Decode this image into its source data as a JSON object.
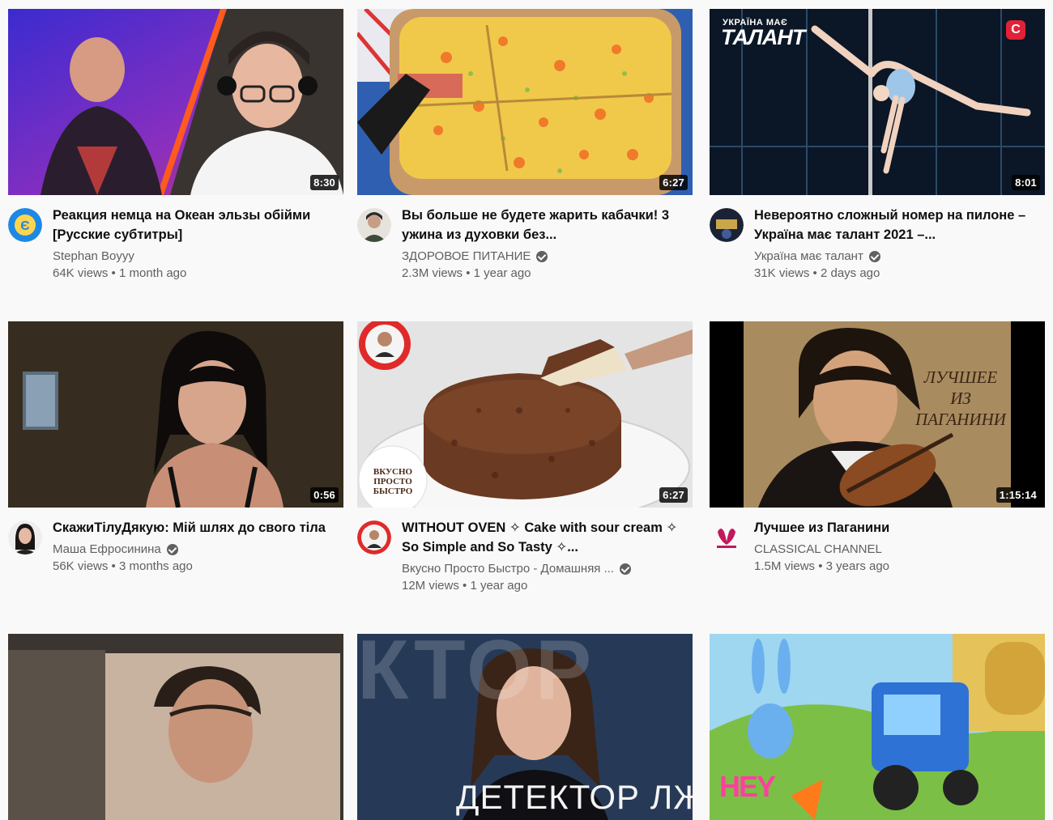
{
  "videos": [
    {
      "title": "Реакция немца на Океан эльзы обійми [Русские субтитры]",
      "channel": "Stephan Boyyy",
      "verified": false,
      "views": "64K views",
      "age": "1 month ago",
      "duration": "8:30",
      "thumbnail_text": ""
    },
    {
      "title": "Вы больше не будете жарить кабачки! 3 ужина из духовки без...",
      "channel": "ЗДОРОВОЕ ПИТАНИЕ",
      "verified": true,
      "views": "2.3M views",
      "age": "1 year ago",
      "duration": "6:27",
      "thumbnail_text": ""
    },
    {
      "title": "Невероятно сложный номер на пилоне – Україна має талант 2021 –...",
      "channel": "Україна має талант",
      "verified": true,
      "views": "31K views",
      "age": "2 days ago",
      "duration": "8:01",
      "thumbnail_text": "ТАЛАНТ",
      "thumbnail_subtext": "УКРАЇНА МАЄ",
      "thumbnail_badge": "С"
    },
    {
      "title": "СкажиТілуДякую: Мій шлях до свого тіла",
      "channel": "Маша Ефросинина",
      "verified": true,
      "views": "56K views",
      "age": "3 months ago",
      "duration": "0:56",
      "thumbnail_text": ""
    },
    {
      "title": "WITHOUT OVEN ✧ Cake with sour cream ✧ So Simple and So Tasty ✧...",
      "channel": "Вкусно Просто Быстро - Домашняя ...",
      "verified": true,
      "views": "12M views",
      "age": "1 year ago",
      "duration": "6:27",
      "thumbnail_text": "ВКУСНО ПРОСТО БЫСТРО"
    },
    {
      "title": "Лучшее из Паганини",
      "channel": "CLASSICAL CHANNEL",
      "verified": false,
      "views": "1.5M views",
      "age": "3 years ago",
      "duration": "1:15:14",
      "thumbnail_text": "ЛУЧШЕЕ ИЗ ПАГАНИНИ"
    },
    {
      "title": "",
      "channel": "",
      "duration": "",
      "thumbnail_text": ""
    },
    {
      "title": "",
      "channel": "",
      "duration": "",
      "thumbnail_text": "ДЕТЕКТОР ЛЖИ",
      "thumbnail_bg_text": "КТОР"
    },
    {
      "title": "",
      "channel": "",
      "duration": "",
      "thumbnail_text": "HEY"
    }
  ],
  "colors": {
    "background": "#f9f9f9",
    "title": "#0f0f0f",
    "secondary": "#606060",
    "duration_bg": "#000000"
  }
}
